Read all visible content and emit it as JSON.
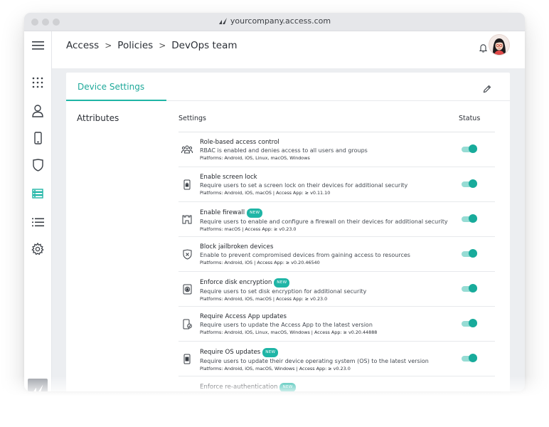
{
  "browser": {
    "url": "yourcompany.access.com"
  },
  "sidebar": {
    "items": [
      {
        "icon": "menu-icon"
      },
      {
        "icon": "apps-grid-icon"
      },
      {
        "icon": "user-icon"
      },
      {
        "icon": "device-icon"
      },
      {
        "icon": "shield-icon"
      },
      {
        "icon": "policies-icon",
        "active": true
      },
      {
        "icon": "list-icon"
      },
      {
        "icon": "gear-icon"
      }
    ]
  },
  "breadcrumb": {
    "items": [
      "Access",
      "Policies",
      "DevOps team"
    ],
    "separator": ">"
  },
  "card": {
    "tab_label": "Device Settings",
    "section_label": "Attributes",
    "col_settings": "Settings",
    "col_status": "Status",
    "new_badge": "NEW"
  },
  "settings": [
    {
      "name": "Role-based access control",
      "is_new": false,
      "desc": "RBAC is enabled and denies access to all users and groups",
      "platforms": "Platforms: Android, iOS, Linux, macOS, Windows",
      "icon": "users-group-icon",
      "enabled": true
    },
    {
      "name": "Enable screen lock",
      "is_new": false,
      "desc": "Require users to set a screen lock on their devices for additional security",
      "platforms": "Platforms: Android, iOS, macOS | Access App: ≥ v0.11.10",
      "icon": "phone-lock-icon",
      "enabled": true
    },
    {
      "name": "Enable firewall",
      "is_new": true,
      "desc": "Require users to enable and configure a firewall on their devices for additional security",
      "platforms": "Platforms: macOS | Access App: ≥ v0.23.0",
      "icon": "firewall-icon",
      "enabled": true
    },
    {
      "name": "Block jailbroken devices",
      "is_new": false,
      "desc": "Enable to prevent compromised devices from gaining access to resources",
      "platforms": "Platforms: Android, iOS | Access App: ≥ v0.20.46540",
      "icon": "shield-x-icon",
      "enabled": true
    },
    {
      "name": "Enforce disk encryption",
      "is_new": true,
      "desc": "Require users to set disk encryption for additional security",
      "platforms": "Platforms: Android, iOS, macOS | Access App: ≥ v0.23.0",
      "icon": "disk-lock-icon",
      "enabled": true
    },
    {
      "name": "Require Access App updates",
      "is_new": false,
      "desc": "Require users to update the Access App to the latest version",
      "platforms": "Platforms: Android, iOS, Linux, macOS, Windows | Access App: ≥ v0.20.44888",
      "icon": "app-update-icon",
      "enabled": true
    },
    {
      "name": "Require OS updates",
      "is_new": true,
      "desc": "Require users to update their device operating system (OS) to the latest version",
      "platforms": "Platforms: Android, iOS, macOS, Windows | Access App: ≥ v0.23.0",
      "icon": "os-update-icon",
      "enabled": true
    },
    {
      "name": "Enforce re-authentication",
      "is_new": true,
      "desc": "",
      "platforms": "",
      "icon": "",
      "enabled": null
    }
  ],
  "colors": {
    "accent": "#1fb5a6",
    "toggle_on": "#18ab9b",
    "toggle_track": "#96dcd4"
  }
}
